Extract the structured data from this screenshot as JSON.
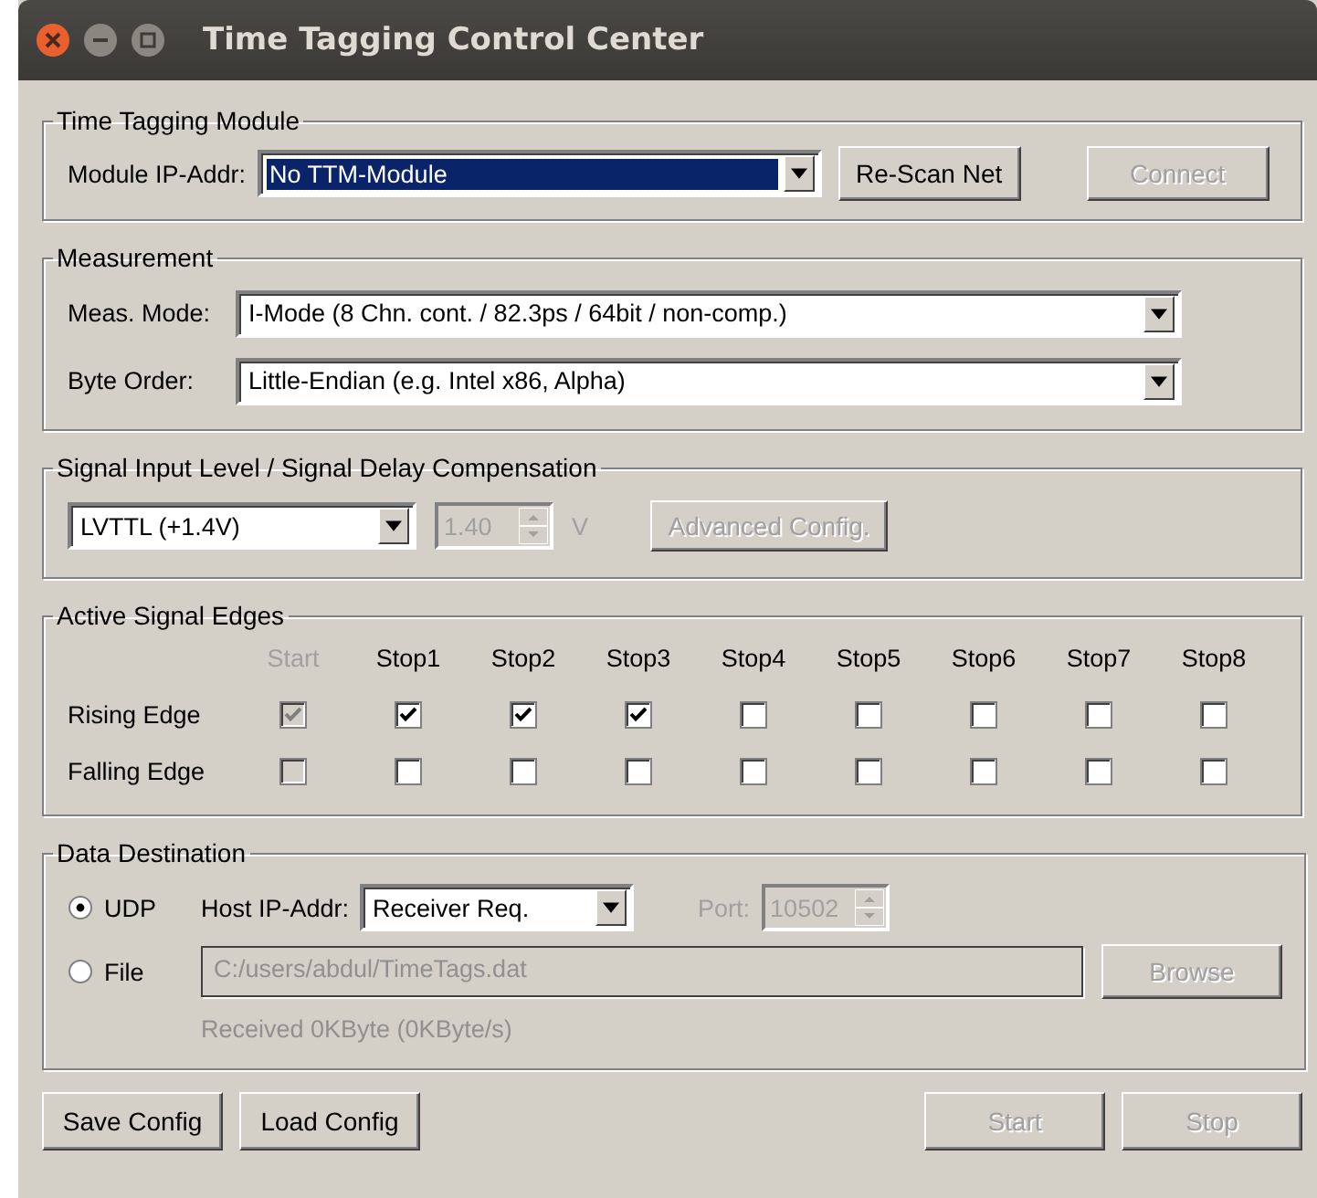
{
  "window": {
    "title": "Time Tagging Control Center"
  },
  "module": {
    "title": "Time Tagging Module",
    "ip_label": "Module IP-Addr:",
    "ip_select": {
      "value": "No TTM-Module",
      "focused": true
    },
    "buttons": [
      {
        "label": "Re-Scan Net",
        "disabled": false
      },
      {
        "label": "Connect",
        "disabled": true
      }
    ]
  },
  "measurement": {
    "title": "Measurement",
    "fields": [
      {
        "label": "Meas. Mode:",
        "value": "I-Mode (8 Chn. cont. / 82.3ps / 64bit / non-comp.)"
      },
      {
        "label": "Byte Order:",
        "value": "Little-Endian (e.g. Intel x86, Alpha)"
      }
    ]
  },
  "signal": {
    "title": "Signal Input Level / Signal Delay Compensation",
    "level_select": "LVTTL (+1.4V)",
    "delay": {
      "value": "1.40",
      "unit": "V",
      "disabled": true
    },
    "advanced_button": {
      "label": "Advanced Config.",
      "disabled": true
    }
  },
  "edges": {
    "title": "Active Signal Edges",
    "columns": [
      {
        "label": "Start",
        "disabled": true
      },
      {
        "label": "Stop1",
        "disabled": false
      },
      {
        "label": "Stop2",
        "disabled": false
      },
      {
        "label": "Stop3",
        "disabled": false
      },
      {
        "label": "Stop4",
        "disabled": false
      },
      {
        "label": "Stop5",
        "disabled": false
      },
      {
        "label": "Stop6",
        "disabled": false
      },
      {
        "label": "Stop7",
        "disabled": false
      },
      {
        "label": "Stop8",
        "disabled": false
      }
    ],
    "rows": [
      {
        "label": "Rising Edge",
        "checked": [
          true,
          true,
          true,
          true,
          false,
          false,
          false,
          false,
          false
        ]
      },
      {
        "label": "Falling Edge",
        "checked": [
          false,
          false,
          false,
          false,
          false,
          false,
          false,
          false,
          false
        ]
      }
    ]
  },
  "destination": {
    "title": "Data Destination",
    "options": [
      {
        "label": "UDP",
        "selected": true
      },
      {
        "label": "File",
        "selected": false
      }
    ],
    "host_label": "Host IP-Addr:",
    "host_select": "Receiver Req.",
    "port_label": "Port:",
    "port_value": "10502",
    "port_disabled": true,
    "file_path": "C:/users/abdul/TimeTags.dat",
    "file_disabled": true,
    "browse": {
      "label": "Browse",
      "disabled": true
    },
    "status": "Received 0KByte (0KByte/s)"
  },
  "footer": {
    "left": [
      {
        "label": "Save Config",
        "disabled": false
      },
      {
        "label": "Load Config",
        "disabled": false
      }
    ],
    "right": [
      {
        "label": "Start",
        "disabled": true
      },
      {
        "label": "Stop",
        "disabled": true
      }
    ]
  }
}
